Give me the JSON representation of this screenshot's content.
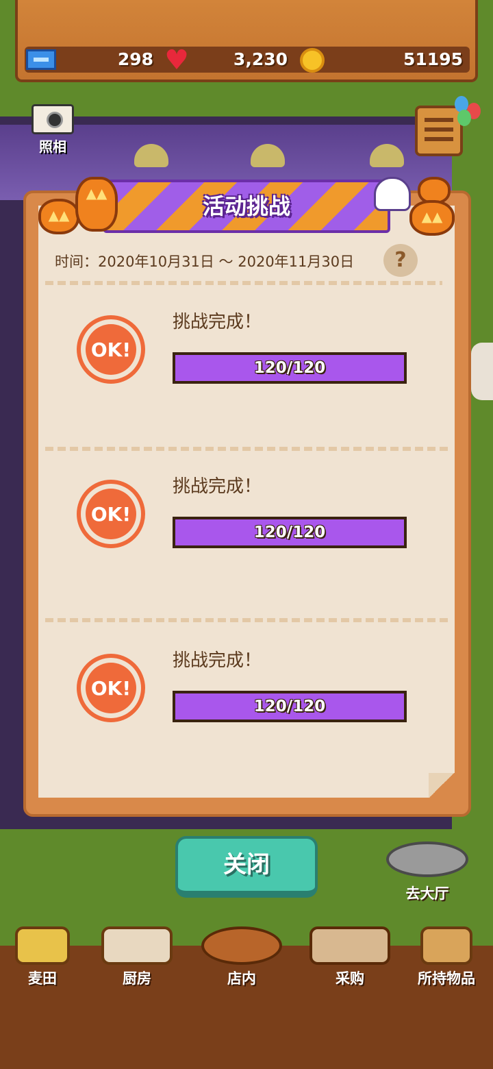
{
  "resources": {
    "tickets": "298",
    "hearts": "3,230",
    "coins": "51195"
  },
  "camera": {
    "label": "照相"
  },
  "dialog": {
    "title": "活动挑战",
    "date_range": "时间：2020年10月31日 ～ 2020年11月30日",
    "help": "?",
    "challenges": [
      {
        "stamp": "OK!",
        "status": "挑战完成！",
        "progress": "120/120",
        "fraction": 1.0
      },
      {
        "stamp": "OK!",
        "status": "挑战完成！",
        "progress": "120/120",
        "fraction": 1.0
      },
      {
        "stamp": "OK!",
        "status": "挑战完成！",
        "progress": "120/120",
        "fraction": 1.0
      }
    ]
  },
  "close_label": "关闭",
  "go_hall_label": "去大厅",
  "nav": [
    {
      "label": "麦田",
      "icon": "wheat-field-icon"
    },
    {
      "label": "厨房",
      "icon": "kitchen-icon"
    },
    {
      "label": "店内",
      "icon": "bread-basket-icon"
    },
    {
      "label": "采购",
      "icon": "shopping-shelf-icon"
    },
    {
      "label": "所持物品",
      "icon": "box-icon"
    }
  ],
  "colors": {
    "accent_purple": "#a957ec",
    "stamp_orange": "#ef6a3a",
    "close_teal": "#49c8ad",
    "wood": "#c4742f"
  }
}
